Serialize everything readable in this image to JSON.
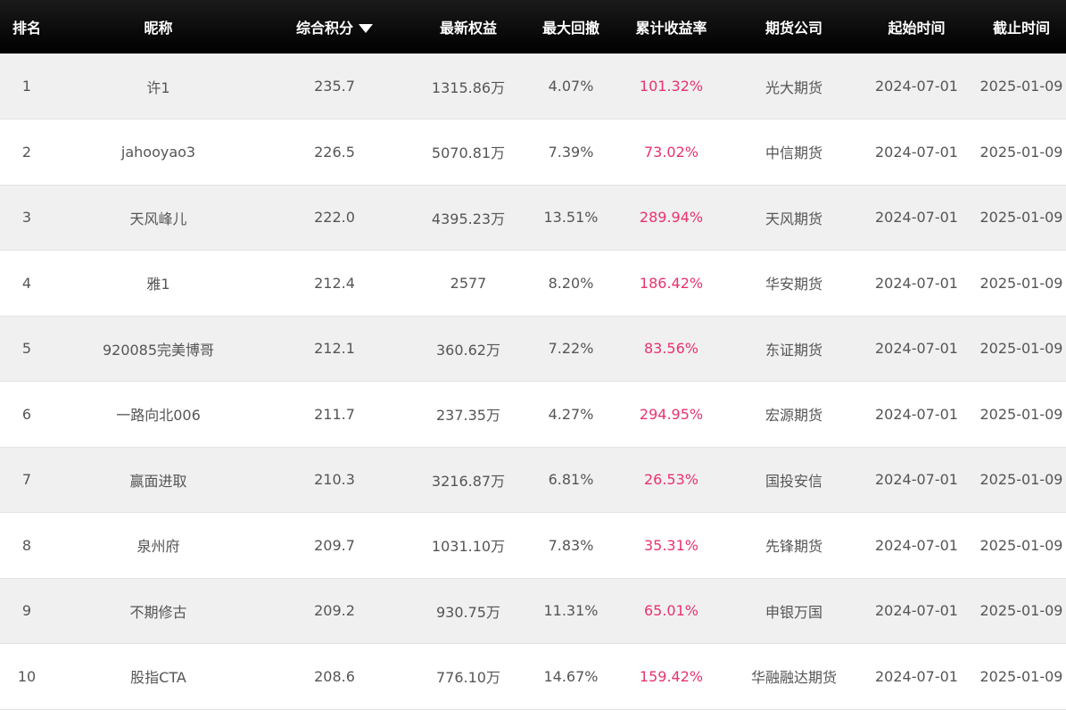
{
  "headers": {
    "rank": "排名",
    "nickname": "昵称",
    "score": "综合积分",
    "equity": "最新权益",
    "drawdown": "最大回撤",
    "return": "累计收益率",
    "company": "期货公司",
    "start": "起始时间",
    "end": "截止时间"
  },
  "sort_icon": "sort-down-triangle",
  "colors": {
    "header_bg": "#000000",
    "return_text": "#e8336d",
    "stripe": "#f0f0f0"
  },
  "rows": [
    {
      "rank": "1",
      "nickname": "许1",
      "score": "235.7",
      "equity": "1315.86万",
      "drawdown": "4.07%",
      "return": "101.32%",
      "company": "光大期货",
      "start": "2024-07-01",
      "end": "2025-01-09"
    },
    {
      "rank": "2",
      "nickname": "jahooyao3",
      "score": "226.5",
      "equity": "5070.81万",
      "drawdown": "7.39%",
      "return": "73.02%",
      "company": "中信期货",
      "start": "2024-07-01",
      "end": "2025-01-09"
    },
    {
      "rank": "3",
      "nickname": "天风峰儿",
      "score": "222.0",
      "equity": "4395.23万",
      "drawdown": "13.51%",
      "return": "289.94%",
      "company": "天风期货",
      "start": "2024-07-01",
      "end": "2025-01-09"
    },
    {
      "rank": "4",
      "nickname": "雅1",
      "score": "212.4",
      "equity": "2577",
      "drawdown": "8.20%",
      "return": "186.42%",
      "company": "华安期货",
      "start": "2024-07-01",
      "end": "2025-01-09"
    },
    {
      "rank": "5",
      "nickname": "920085完美博哥",
      "score": "212.1",
      "equity": "360.62万",
      "drawdown": "7.22%",
      "return": "83.56%",
      "company": "东证期货",
      "start": "2024-07-01",
      "end": "2025-01-09"
    },
    {
      "rank": "6",
      "nickname": "一路向北006",
      "score": "211.7",
      "equity": "237.35万",
      "drawdown": "4.27%",
      "return": "294.95%",
      "company": "宏源期货",
      "start": "2024-07-01",
      "end": "2025-01-09"
    },
    {
      "rank": "7",
      "nickname": "赢面进取",
      "score": "210.3",
      "equity": "3216.87万",
      "drawdown": "6.81%",
      "return": "26.53%",
      "company": "国投安信",
      "start": "2024-07-01",
      "end": "2025-01-09"
    },
    {
      "rank": "8",
      "nickname": "泉州府",
      "score": "209.7",
      "equity": "1031.10万",
      "drawdown": "7.83%",
      "return": "35.31%",
      "company": "先锋期货",
      "start": "2024-07-01",
      "end": "2025-01-09"
    },
    {
      "rank": "9",
      "nickname": "不期修古",
      "score": "209.2",
      "equity": "930.75万",
      "drawdown": "11.31%",
      "return": "65.01%",
      "company": "申银万国",
      "start": "2024-07-01",
      "end": "2025-01-09"
    },
    {
      "rank": "10",
      "nickname": "股指CTA",
      "score": "208.6",
      "equity": "776.10万",
      "drawdown": "14.67%",
      "return": "159.42%",
      "company": "华融融达期货",
      "start": "2024-07-01",
      "end": "2025-01-09"
    }
  ]
}
